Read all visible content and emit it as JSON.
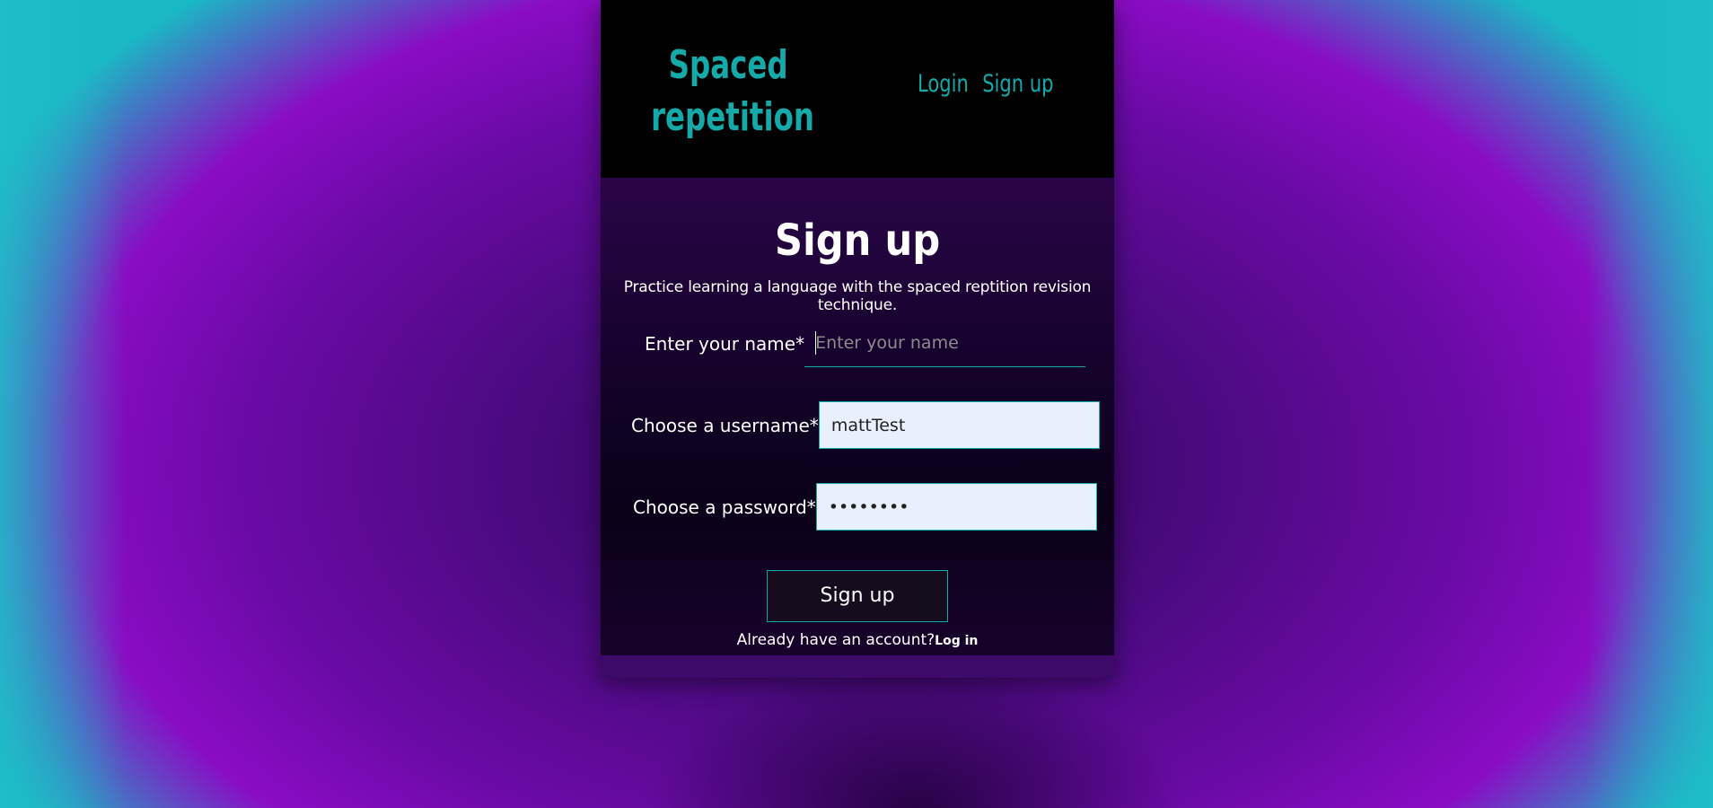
{
  "brand": {
    "logo_line1": "Spaced",
    "logo_line2": "repetition",
    "color": "#16a9a9"
  },
  "nav": {
    "login": "Login",
    "signup": "Sign up"
  },
  "form": {
    "title": "Sign up",
    "subtitle": "Practice learning a language with the spaced reptition revision technique.",
    "name": {
      "label": "Enter your name*",
      "placeholder": "Enter your name",
      "value": ""
    },
    "username": {
      "label": "Choose a username*",
      "value": "mattTest"
    },
    "password": {
      "label": "Choose a password*",
      "value": "••••••••"
    },
    "submit_label": "Sign up",
    "already_text": "Already have an account?",
    "login_link": "Log in"
  }
}
